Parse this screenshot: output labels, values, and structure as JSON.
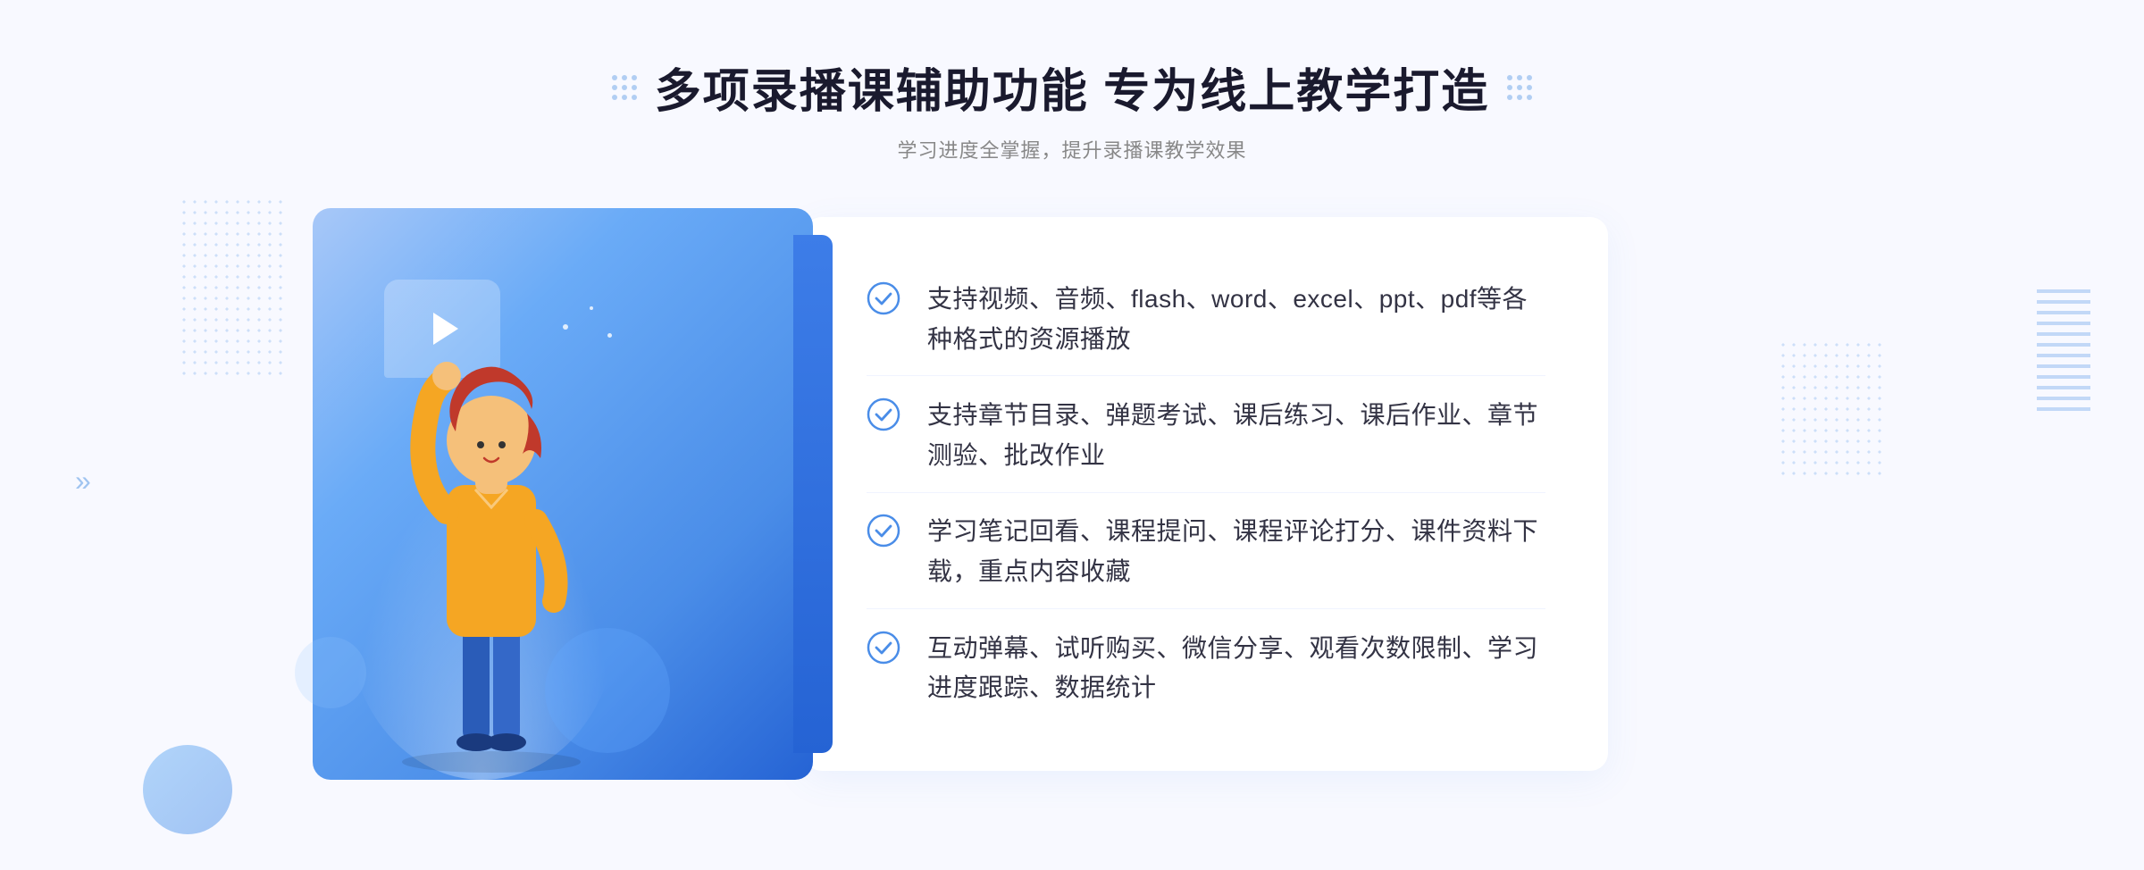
{
  "header": {
    "title": "多项录播课辅助功能 专为线上教学打造",
    "subtitle": "学习进度全掌握，提升录播课教学效果"
  },
  "features": [
    {
      "id": 1,
      "text": "支持视频、音频、flash、word、excel、ppt、pdf等各种格式的资源播放"
    },
    {
      "id": 2,
      "text": "支持章节目录、弹题考试、课后练习、课后作业、章节测验、批改作业"
    },
    {
      "id": 3,
      "text": "学习笔记回看、课程提问、课程评论打分、课件资料下载，重点内容收藏"
    },
    {
      "id": 4,
      "text": "互动弹幕、试听购买、微信分享、观看次数限制、学习进度跟踪、数据统计"
    }
  ],
  "decorations": {
    "chevron_left": "»",
    "play_icon": "▶"
  },
  "colors": {
    "primary_blue": "#4a8de8",
    "light_blue": "#a8c8f8",
    "dark_blue": "#2563d4",
    "text_dark": "#333344",
    "text_gray": "#888888",
    "check_color": "#4a8de8"
  }
}
